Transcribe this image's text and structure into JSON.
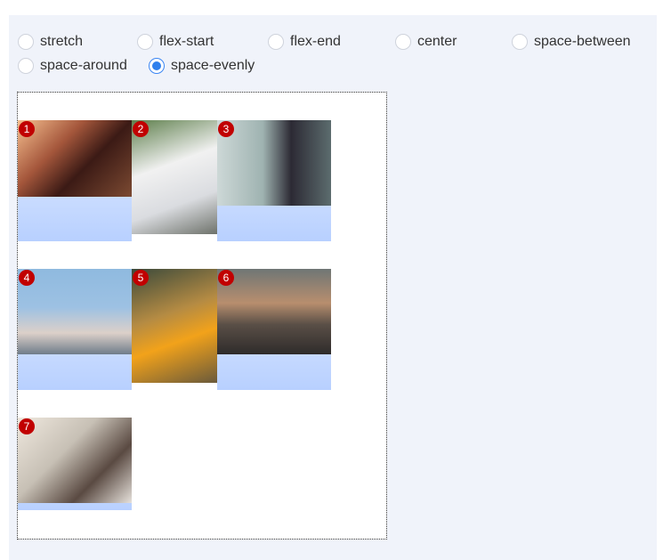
{
  "radio_options": [
    {
      "label": "stretch",
      "selected": false
    },
    {
      "label": "flex-start",
      "selected": false
    },
    {
      "label": "flex-end",
      "selected": false
    },
    {
      "label": "center",
      "selected": false
    },
    {
      "label": "space-between",
      "selected": false
    },
    {
      "label": "space-around",
      "selected": false
    },
    {
      "label": "space-evenly",
      "selected": true
    }
  ],
  "items": [
    {
      "number": "1"
    },
    {
      "number": "2"
    },
    {
      "number": "3"
    },
    {
      "number": "4"
    },
    {
      "number": "5"
    },
    {
      "number": "6"
    },
    {
      "number": "7"
    }
  ],
  "colors": {
    "accent": "#2f80ed",
    "badge": "#c10000",
    "panel_bg": "#f0f3fa"
  }
}
